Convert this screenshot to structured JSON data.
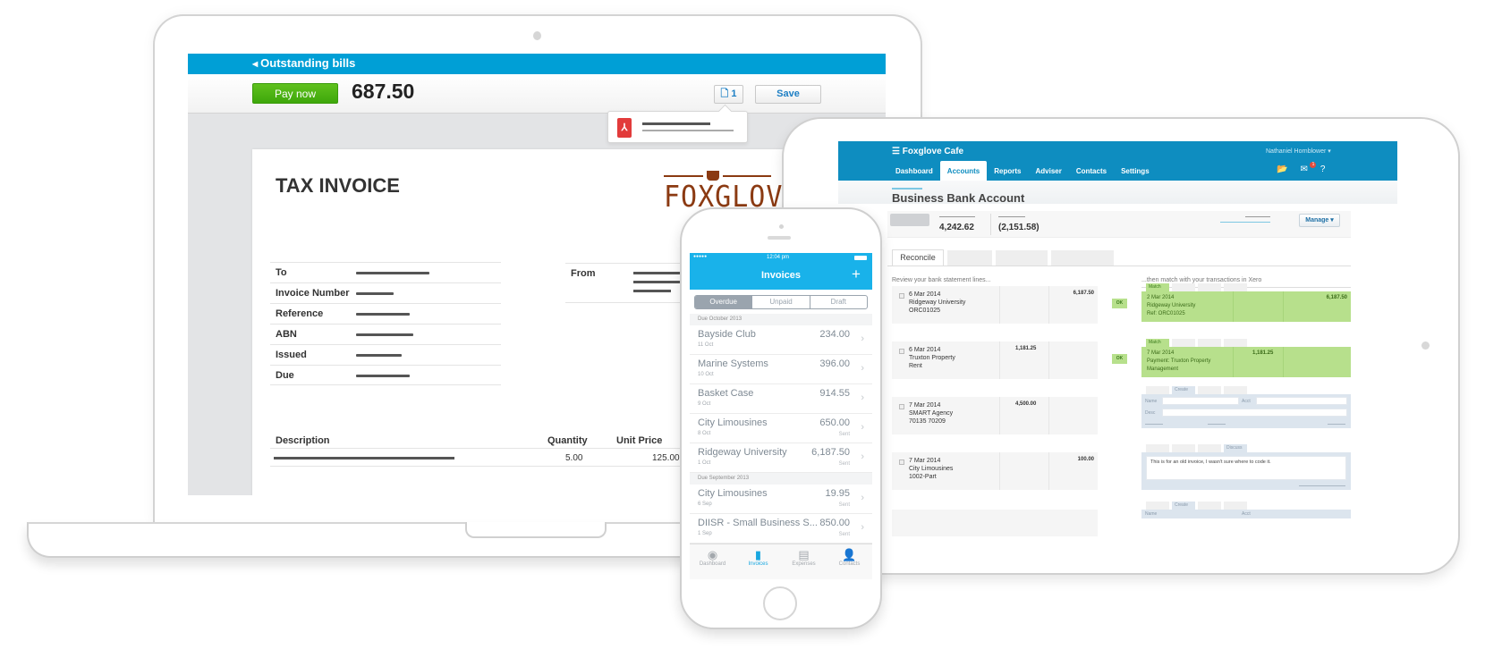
{
  "laptop": {
    "bills_bar": {
      "back_label": "Outstanding bills"
    },
    "action_bar": {
      "pay_button": "Pay now",
      "amount": "687.50",
      "attachments_count": "1",
      "save_button": "Save"
    },
    "invoice": {
      "title": "TAX INVOICE",
      "logo_text": "FOXGLOVE",
      "fields": [
        {
          "label": "To"
        },
        {
          "label": "Invoice Number"
        },
        {
          "label": "Reference"
        },
        {
          "label": "ABN"
        },
        {
          "label": "Issued"
        },
        {
          "label": "Due"
        }
      ],
      "from_label": "From",
      "line_items": {
        "headers": {
          "description": "Description",
          "quantity": "Quantity",
          "unit_price": "Unit Price"
        },
        "rows": [
          {
            "quantity": "5.00",
            "unit_price": "125.00"
          }
        ]
      }
    }
  },
  "tablet": {
    "org_name": "Foxglove Cafe",
    "user_name": "Nathaniel Hornblower",
    "nav": [
      "Dashboard",
      "Accounts",
      "Reports",
      "Adviser",
      "Contacts",
      "Settings"
    ],
    "active_nav": "Accounts",
    "notification_count": "1",
    "page_title": "Business Bank Account",
    "stats": {
      "statement_balance": "4,242.62",
      "xero_balance": "(2,151.58)"
    },
    "manage_button": "Manage",
    "tab_reconcile": "Reconcile",
    "review_label": "Review your bank statement lines...",
    "match_label": "...then match with your transactions in Xero",
    "statement_lines": [
      {
        "date": "6 Mar 2014",
        "payee": "Ridgeway University",
        "ref": "ORC01025",
        "spent": "",
        "received": "6,187.50"
      },
      {
        "date": "6 Mar 2014",
        "payee": "Truxton Property",
        "ref": "Rent",
        "spent": "1,181.25",
        "received": ""
      },
      {
        "date": "7 Mar 2014",
        "payee": "SMART Agency",
        "ref": "70135 70209",
        "spent": "4,500.00",
        "received": ""
      },
      {
        "date": "7 Mar 2014",
        "payee": "City Limousines",
        "ref": "1002-Part",
        "spent": "",
        "received": "100.00"
      }
    ],
    "ok_button": "OK",
    "matches": [
      {
        "tab": "Match",
        "date": "2 Mar 2014",
        "line1": "Ridgeway University",
        "line2": "Ref: ORC01025",
        "spent": "",
        "received": "6,187.50"
      },
      {
        "tab": "Match",
        "date": "7 Mar 2014",
        "line1": "Payment: Truxton Property",
        "line2": "Management",
        "spent": "1,181.25",
        "received": ""
      }
    ],
    "create_tab": "Create",
    "discuss_tab": "Discuss",
    "name_label": "Name",
    "acct_label": "Acct",
    "desc_label": "Desc",
    "discuss_text": "This is for an old invoice, I wasn't sure where to code it."
  },
  "phone": {
    "status_signal": "●●●●●",
    "status_time": "12:04 pm",
    "title": "Invoices",
    "segments": [
      "Overdue",
      "Unpaid",
      "Draft"
    ],
    "active_segment": "Overdue",
    "sections": [
      {
        "heading": "Due October 2013",
        "items": [
          {
            "name": "Bayside Club",
            "date": "11 Oct",
            "amount": "234.00",
            "status": ""
          },
          {
            "name": "Marine Systems",
            "date": "10 Oct",
            "amount": "396.00",
            "status": ""
          },
          {
            "name": "Basket Case",
            "date": "9 Oct",
            "amount": "914.55",
            "status": ""
          },
          {
            "name": "City Limousines",
            "date": "8 Oct",
            "amount": "650.00",
            "status": "Sent"
          },
          {
            "name": "Ridgeway University",
            "date": "1 Oct",
            "amount": "6,187.50",
            "status": "Sent"
          }
        ]
      },
      {
        "heading": "Due September 2013",
        "items": [
          {
            "name": "City Limousines",
            "date": "6 Sep",
            "amount": "19.95",
            "status": "Sent"
          },
          {
            "name": "DIISR - Small Business S...",
            "date": "1 Sep",
            "amount": "850.00",
            "status": "Sent"
          }
        ]
      }
    ],
    "tabbar": [
      {
        "label": "Dashboard",
        "icon": "dashboard-icon"
      },
      {
        "label": "Invoices",
        "icon": "invoice-icon"
      },
      {
        "label": "Expenses",
        "icon": "expenses-icon"
      },
      {
        "label": "Contacts",
        "icon": "contacts-icon"
      }
    ],
    "active_tab": "Invoices"
  },
  "colors": {
    "xero_blue": "#009fd6",
    "phone_blue": "#19b2ea",
    "pay_green": "#4cb415",
    "match_green": "#b7e08c",
    "logo_brown": "#8b3a12"
  }
}
